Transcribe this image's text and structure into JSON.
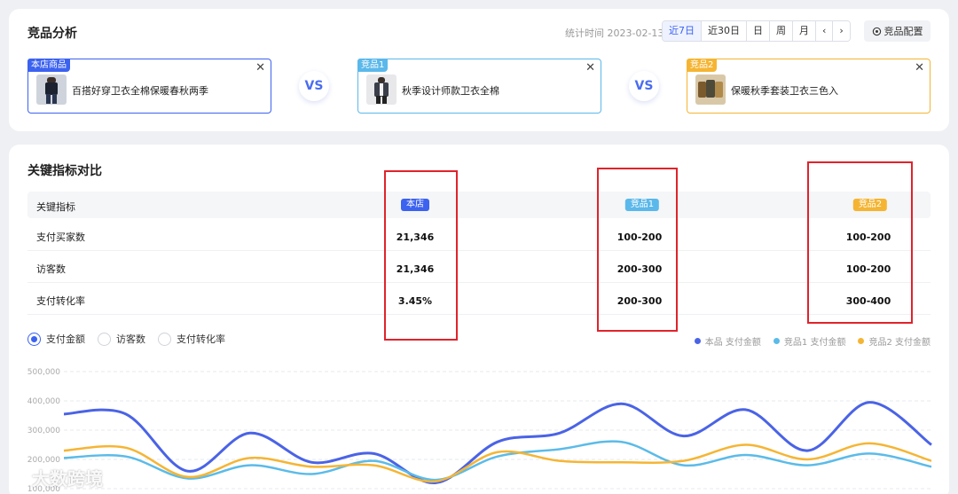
{
  "top": {
    "title": "竞品分析",
    "stat_time_label": "统计时间 2023-02-13",
    "periods": [
      "近7日",
      "近30日",
      "日",
      "周",
      "月"
    ],
    "active_period": 0,
    "prev": "‹",
    "next": "›",
    "config_label": "竞品配置",
    "vs_label": "VS",
    "products": [
      {
        "tag": "本店商品",
        "name": "百搭好穿卫衣全棉保暖春秋两季",
        "color": "#3c62f0",
        "img_bg": "#cfd4dc",
        "img_fg": "#1d2230"
      },
      {
        "tag": "竞品1",
        "name": "秋季设计师款卫衣全棉",
        "color": "#5bb8ea",
        "img_bg": "#e8e8ea",
        "img_fg": "#3a3f4a"
      },
      {
        "tag": "竞品2",
        "name": "保暖秋季套装卫衣三色入",
        "color": "#f5b533",
        "img_bg": "#d9c8a8",
        "img_fg": "#7a5a2c"
      }
    ]
  },
  "metrics": {
    "title": "关键指标对比",
    "header": {
      "label": "关键指标",
      "cols": [
        "本店",
        "竞品1",
        "竞品2"
      ]
    },
    "rows": [
      {
        "label": "支付买家数",
        "values": [
          "21,346",
          "100-200",
          "100-200"
        ]
      },
      {
        "label": "访客数",
        "values": [
          "21,346",
          "200-300",
          "100-200"
        ]
      },
      {
        "label": "支付转化率",
        "values": [
          "3.45%",
          "200-300",
          "300-400"
        ]
      }
    ],
    "radios": [
      "支付金额",
      "访客数",
      "支付转化率"
    ],
    "active_radio": 0
  },
  "chart_data": {
    "type": "line",
    "y_ticks": [
      "500,000",
      "400,000",
      "300,000",
      "200,000",
      "100,000"
    ],
    "ylim": [
      100000,
      500000
    ],
    "grid": true,
    "legend_position": "top-right",
    "series": [
      {
        "name": "本品 支付金额",
        "color": "#4a63e6",
        "values": [
          355000,
          355000,
          160000,
          290000,
          190000,
          220000,
          120000,
          260000,
          290000,
          390000,
          280000,
          370000,
          230000,
          395000,
          250000
        ]
      },
      {
        "name": "竞品1 支付金额",
        "color": "#5bbbe8",
        "values": [
          205000,
          210000,
          135000,
          180000,
          150000,
          195000,
          130000,
          210000,
          235000,
          260000,
          180000,
          215000,
          180000,
          220000,
          175000
        ]
      },
      {
        "name": "竞品2 支付金额",
        "color": "#f5b534",
        "values": [
          230000,
          240000,
          140000,
          205000,
          175000,
          180000,
          125000,
          225000,
          195000,
          190000,
          195000,
          250000,
          200000,
          255000,
          195000
        ]
      }
    ]
  },
  "watermark": "大数跨境"
}
